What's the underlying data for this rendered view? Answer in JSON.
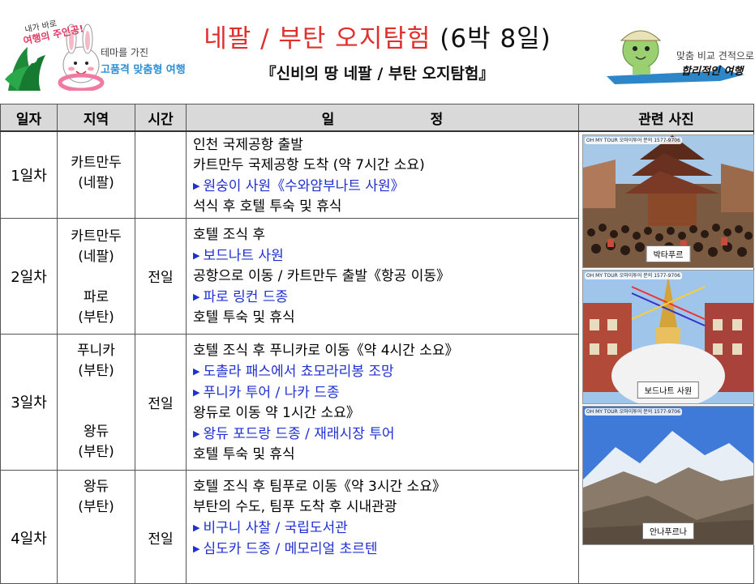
{
  "header": {
    "title_main": "네팔 / 부탄 오지탐험",
    "title_suffix": "(6박 8일)",
    "subtitle": "『신비의 땅 네팔 / 부탄 오지탐험』",
    "left_brand": {
      "script_line1": "내가 바로",
      "script_line2": "여행의 주인공!",
      "tagline": "테마를 가진",
      "strong": "고품격 맞춤형 여행"
    },
    "right_brand": {
      "tagline": "맞춤 비교 견적으로",
      "strong": "합리적인 여행"
    },
    "colors": {
      "title_red": "#e0302c",
      "highlight_blue": "#1f2fd1"
    }
  },
  "table": {
    "headers": [
      "일자",
      "지역",
      "시간",
      "일                    정",
      "관련 사진"
    ],
    "rows": [
      {
        "day": "1일차",
        "regions": [
          "카트만두",
          "(네팔)"
        ],
        "time": "",
        "lines": [
          {
            "text": "인천 국제공항 출발",
            "hl": false
          },
          {
            "text": "카트만두 국제공항 도착 (약 7시간 소요)",
            "hl": false
          },
          {
            "text": "원숭이 사원《수와얌부나트 사원》",
            "hl": true
          },
          {
            "text": "석식 후 호텔 투숙 및 휴식",
            "hl": false
          }
        ]
      },
      {
        "day": "2일차",
        "regions": [
          "카트만두",
          "(네팔)",
          "",
          "파로",
          "(부탄)"
        ],
        "time": "전일",
        "lines": [
          {
            "text": "호텔 조식 후",
            "hl": false
          },
          {
            "text": "보드나트 사원",
            "hl": true
          },
          {
            "text": "공항으로 이동 / 카트만두 출발《항공 이동》",
            "hl": false
          },
          {
            "text": "파로 링컨 드종",
            "hl": true
          },
          {
            "text": "호텔 투숙 및 휴식",
            "hl": false
          }
        ]
      },
      {
        "day": "3일차",
        "regions": [
          "푸니카",
          "(부탄)",
          "",
          "",
          "왕듀",
          "(부탄)"
        ],
        "time": "전일",
        "lines": [
          {
            "text": "호텔 조식 후 푸니카로 이동《약 4시간 소요》",
            "hl": false
          },
          {
            "text": "도촐라 패스에서 쵸모라리봉 조망",
            "hl": true
          },
          {
            "text": "푸니카 투어 / 나카 드종",
            "hl": true
          },
          {
            "text": "왕듀로 이동  약 1시간 소요》",
            "hl": false
          },
          {
            "text": "왕듀 포드랑 드종 / 재래시장 투어",
            "hl": true
          },
          {
            "text": "호텔 투숙 및 휴식",
            "hl": false
          }
        ]
      },
      {
        "day": "4일차",
        "regions": [
          "왕듀",
          "(부탄)"
        ],
        "time": "전일",
        "lines": [
          {
            "text": "호텔 조식 후 팀푸로 이동《약 3시간 소요》",
            "hl": false
          },
          {
            "text": "부탄의 수도, 팀푸 도착 후 시내관광",
            "hl": false
          },
          {
            "text": "비구니 사찰 / 국립도서관",
            "hl": true
          },
          {
            "text": "심도카 드종 / 메모리얼 초르텐",
            "hl": true
          }
        ]
      }
    ],
    "photos": [
      {
        "caption": "박타푸르",
        "badge": "OH MY TOUR 오마이투어 문의 1577-9706"
      },
      {
        "caption": "보드나트 사원",
        "badge": "OH MY TOUR 오마이투어 문의 1577-9706"
      },
      {
        "caption": "안나푸르나",
        "badge": "OH MY TOUR 오마이투어 문의 1577-9706"
      }
    ]
  }
}
